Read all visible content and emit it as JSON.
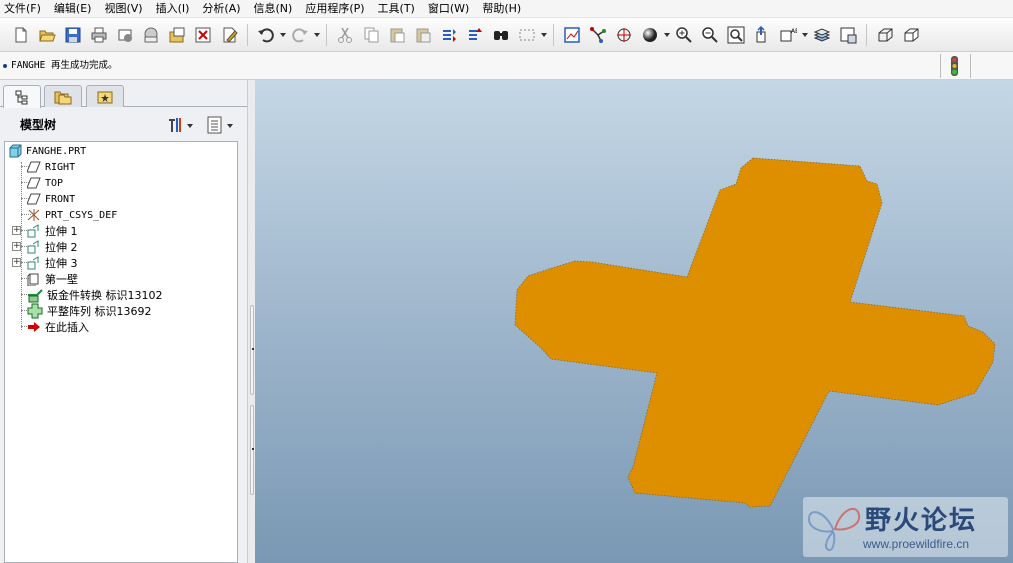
{
  "menu": [
    "文件(F)",
    "编辑(E)",
    "视图(V)",
    "插入(I)",
    "分析(A)",
    "信息(N)",
    "应用程序(P)",
    "工具(T)",
    "窗口(W)",
    "帮助(H)"
  ],
  "toolbar": {
    "icons": [
      "new-file-icon",
      "open-file-icon",
      "save-icon",
      "print-icon",
      "send-mail-icon",
      "mail-icon",
      "rename-icon",
      "close-window-icon",
      "edit-definition-icon",
      "undo-icon",
      "redo-icon",
      "cut-icon",
      "copy-icon",
      "paste-icon",
      "paste-special-icon",
      "regenerate-icon",
      "regenerate-manager-icon",
      "find-icon",
      "select-box-icon",
      "datum-display-icon",
      "datum-axis-icon",
      "spin-center-icon",
      "shading-icon",
      "zoom-in-icon",
      "zoom-out-icon",
      "refit-icon",
      "reorient-icon",
      "saved-views-icon",
      "layers-icon",
      "view-manager-icon",
      "wireframe-icon",
      "hidden-line-icon"
    ]
  },
  "message": {
    "text": "FANGHE 再生成功完成。"
  },
  "model_tree": {
    "title": "模型树",
    "items": [
      {
        "label": "FANGHE.PRT",
        "icon": "part-icon"
      },
      {
        "label": "RIGHT",
        "icon": "datum-plane-icon"
      },
      {
        "label": "TOP",
        "icon": "datum-plane-icon"
      },
      {
        "label": "FRONT",
        "icon": "datum-plane-icon"
      },
      {
        "label": "PRT_CSYS_DEF",
        "icon": "csys-icon"
      },
      {
        "label": "拉伸 1",
        "icon": "extrude-icon"
      },
      {
        "label": "拉伸 2",
        "icon": "extrude-icon"
      },
      {
        "label": "拉伸 3",
        "icon": "extrude-icon"
      },
      {
        "label": "第一壁",
        "icon": "first-wall-icon"
      },
      {
        "label": "钣金件转换  标识13102",
        "icon": "sheetmetal-convert-icon"
      },
      {
        "label": "平整阵列  标识13692",
        "icon": "flatten-pattern-icon"
      },
      {
        "label": "在此插入",
        "icon": "insert-here-arrow-icon"
      }
    ]
  },
  "colors": {
    "part": "#dd8f00",
    "insert_arrow": "#d40000",
    "viewport_top": "#c4d7e6",
    "viewport_bottom": "#7a98b4"
  },
  "watermark": {
    "title": "野火论坛",
    "url": "www.proewildfire.cn"
  }
}
